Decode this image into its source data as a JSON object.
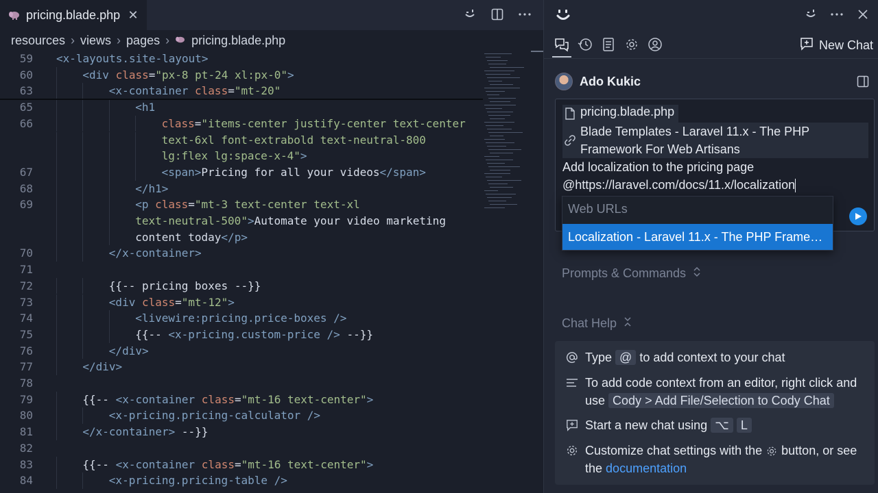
{
  "editor": {
    "tab": {
      "label": "pricing.blade.php",
      "icon": "php-elephant-icon"
    },
    "breadcrumb": [
      "resources",
      "views",
      "pages",
      "pricing.blade.php"
    ],
    "lines": [
      {
        "n": "59",
        "tokens": [
          [
            "tag",
            "<x-layouts.site-layout"
          ],
          [
            "tag",
            ">"
          ]
        ],
        "indent": 0
      },
      {
        "n": "60",
        "tokens": [
          [
            "tag",
            "<div "
          ],
          [
            "attr",
            "class"
          ],
          [
            "plain",
            "="
          ],
          [
            "str",
            "\"px-8 pt-24 xl:px-0\""
          ],
          [
            "tag",
            ">"
          ]
        ],
        "indent": 1
      },
      {
        "n": "63",
        "tokens": [
          [
            "tag",
            "<x-container "
          ],
          [
            "attr",
            "class"
          ],
          [
            "plain",
            "="
          ],
          [
            "str",
            "\"mt-20\""
          ]
        ],
        "indent": 2
      },
      {
        "n": "65",
        "tokens": [
          [
            "tag",
            "<h1"
          ]
        ],
        "indent": 3
      },
      {
        "n": "66",
        "tokens": [
          [
            "attr",
            "class"
          ],
          [
            "plain",
            "="
          ],
          [
            "str",
            "\"items-center justify-center text-center"
          ]
        ],
        "indent": 4
      },
      {
        "n": "",
        "tokens": [
          [
            "str",
            "text-6xl font-extrabold text-neutral-800"
          ]
        ],
        "indent": 4
      },
      {
        "n": "",
        "tokens": [
          [
            "str",
            "lg:flex lg:space-x-4\""
          ],
          [
            "tag",
            ">"
          ]
        ],
        "indent": 4
      },
      {
        "n": "67",
        "tokens": [
          [
            "tag",
            "<span>"
          ],
          [
            "plain",
            "Pricing for all your videos"
          ],
          [
            "tag",
            "</span>"
          ]
        ],
        "indent": 4
      },
      {
        "n": "68",
        "tokens": [
          [
            "tag",
            "</h1>"
          ]
        ],
        "indent": 3
      },
      {
        "n": "69",
        "tokens": [
          [
            "tag",
            "<p "
          ],
          [
            "attr",
            "class"
          ],
          [
            "plain",
            "="
          ],
          [
            "str",
            "\"mt-3 text-center text-xl"
          ]
        ],
        "indent": 3
      },
      {
        "n": "",
        "tokens": [
          [
            "str",
            "text-neutral-500\""
          ],
          [
            "tag",
            ">"
          ],
          [
            "plain",
            "Automate your video marketing"
          ]
        ],
        "indent": 3
      },
      {
        "n": "",
        "tokens": [
          [
            "plain",
            "content today"
          ],
          [
            "tag",
            "</p>"
          ]
        ],
        "indent": 3
      },
      {
        "n": "70",
        "tokens": [
          [
            "tag",
            "</x-container>"
          ]
        ],
        "indent": 2
      },
      {
        "n": "71",
        "tokens": [],
        "indent": 0
      },
      {
        "n": "72",
        "tokens": [
          [
            "plain",
            "{{-- pricing boxes --}}"
          ]
        ],
        "indent": 2
      },
      {
        "n": "73",
        "tokens": [
          [
            "tag",
            "<div "
          ],
          [
            "attr",
            "class"
          ],
          [
            "plain",
            "="
          ],
          [
            "str",
            "\"mt-12\""
          ],
          [
            "tag",
            ">"
          ]
        ],
        "indent": 2
      },
      {
        "n": "74",
        "tokens": [
          [
            "tag",
            "<livewire:pricing.price-boxes />"
          ]
        ],
        "indent": 3
      },
      {
        "n": "75",
        "tokens": [
          [
            "plain",
            "{{-- "
          ],
          [
            "tag",
            "<x-pricing.custom-price />"
          ],
          [
            "plain",
            " --}}"
          ]
        ],
        "indent": 3
      },
      {
        "n": "76",
        "tokens": [
          [
            "tag",
            "</div>"
          ]
        ],
        "indent": 2
      },
      {
        "n": "77",
        "tokens": [
          [
            "tag",
            "</div>"
          ]
        ],
        "indent": 1
      },
      {
        "n": "78",
        "tokens": [],
        "indent": 0
      },
      {
        "n": "79",
        "tokens": [
          [
            "plain",
            "{{-- "
          ],
          [
            "tag",
            "<x-container "
          ],
          [
            "attr",
            "class"
          ],
          [
            "plain",
            "="
          ],
          [
            "str",
            "\"mt-16 text-center\""
          ],
          [
            "tag",
            ">"
          ]
        ],
        "indent": 1
      },
      {
        "n": "80",
        "tokens": [
          [
            "tag",
            "<x-pricing.pricing-calculator />"
          ]
        ],
        "indent": 2
      },
      {
        "n": "81",
        "tokens": [
          [
            "tag",
            "</x-container>"
          ],
          [
            "plain",
            " --}}"
          ]
        ],
        "indent": 1
      },
      {
        "n": "82",
        "tokens": [],
        "indent": 0
      },
      {
        "n": "83",
        "tokens": [
          [
            "plain",
            "{{-- "
          ],
          [
            "tag",
            "<x-container "
          ],
          [
            "attr",
            "class"
          ],
          [
            "plain",
            "="
          ],
          [
            "str",
            "\"mt-16 text-center\""
          ],
          [
            "tag",
            ">"
          ]
        ],
        "indent": 1
      },
      {
        "n": "84",
        "tokens": [
          [
            "tag",
            "<x-pricing.pricing-table />"
          ]
        ],
        "indent": 2
      }
    ]
  },
  "panel": {
    "new_chat_label": "New Chat",
    "user_name": "Ado Kukic",
    "context": {
      "file": "pricing.blade.php",
      "link": "Blade Templates - Laravel 11.x - The PHP Framework For Web Artisans"
    },
    "prompt_line1": "Add localization to the pricing page",
    "prompt_line2": "@https://laravel.com/docs/11.x/localization",
    "popup": {
      "heading": "Web URLs",
      "option": "Localization - Laravel 11.x - The PHP Frame…"
    },
    "prompts_title": "Prompts & Commands",
    "help_title": "Chat Help",
    "help": {
      "row1_a": "Type",
      "row1_kbd": "@",
      "row1_b": "to add context to your chat",
      "row2_a": "To add code context from an editor, right click and use",
      "row2_kbd": "Cody > Add File/Selection to Cody Chat",
      "row3_a": "Start a new chat using",
      "row3_kbd1": "⌥",
      "row3_kbd2": "L",
      "row4_a": "Customize chat settings with the",
      "row4_b": "button, or see the",
      "row4_link": "documentation"
    }
  },
  "colors": {
    "accent": "#1976d2",
    "send": "#1e88e5",
    "link": "#4ea1ff"
  }
}
